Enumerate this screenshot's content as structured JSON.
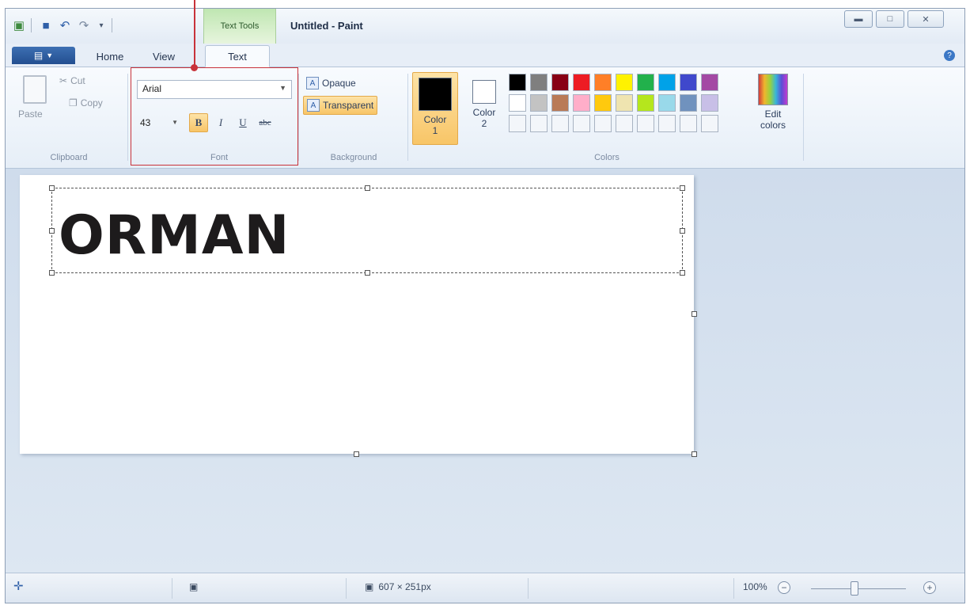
{
  "window": {
    "title": "Untitled - Paint",
    "contextual_tab": "Text Tools"
  },
  "ribbon_tabs": {
    "home": "Home",
    "view": "View",
    "text": "Text"
  },
  "clipboard": {
    "paste": "Paste",
    "cut": "Cut",
    "copy": "Copy",
    "group_label": "Clipboard"
  },
  "font": {
    "family": "Arial",
    "size": "43",
    "bold": "B",
    "italic": "I",
    "underline": "U",
    "strikethrough": "abc",
    "group_label": "Font"
  },
  "background": {
    "opaque": "Opaque",
    "transparent": "Transparent",
    "group_label": "Background"
  },
  "colors": {
    "color1_label": "Color",
    "color1_num": "1",
    "color2_label": "Color",
    "color2_num": "2",
    "color1": "#000000",
    "color2": "#ffffff",
    "edit_colors_1": "Edit",
    "edit_colors_2": "colors",
    "group_label": "Colors",
    "palette": [
      "#000000",
      "#7f7f7f",
      "#880015",
      "#ed1c24",
      "#ff7f27",
      "#fff200",
      "#22b14c",
      "#00a2e8",
      "#3f48cc",
      "#a349a4",
      "#ffffff",
      "#c3c3c3",
      "#b97a57",
      "#ffaec9",
      "#ffc90e",
      "#efe4b0",
      "#b5e61d",
      "#99d9ea",
      "#7092be",
      "#c8bfe7",
      "#f3f6fa",
      "#f3f6fa",
      "#f3f6fa",
      "#f3f6fa",
      "#f3f6fa",
      "#f3f6fa",
      "#f3f6fa",
      "#f3f6fa",
      "#f3f6fa",
      "#f3f6fa"
    ]
  },
  "canvas": {
    "text": "ORMAN"
  },
  "status": {
    "dimensions": "607 × 251px",
    "zoom": "100%"
  }
}
